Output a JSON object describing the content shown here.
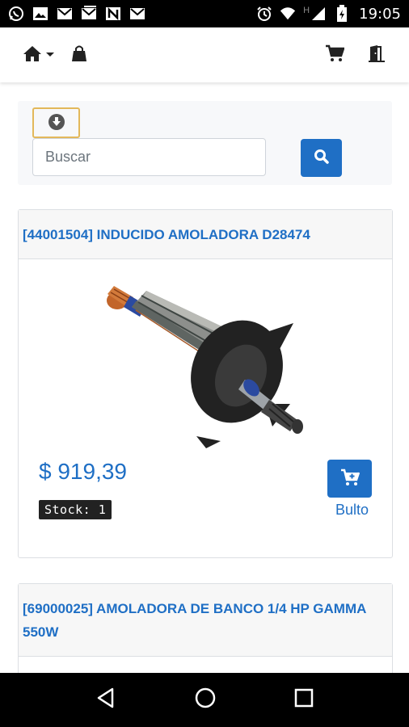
{
  "status_bar": {
    "time": "19:05",
    "network_label": "H",
    "left_icons": [
      "whatsapp-icon",
      "image-icon",
      "gmail-icon",
      "gmail-icon",
      "n-app-icon",
      "gmail-icon"
    ],
    "right_icons": [
      "alarm-icon",
      "wifi-icon",
      "signal-icon",
      "battery-charging-icon"
    ]
  },
  "navbar": {
    "icons": [
      "home-icon",
      "caret-down-icon",
      "shopping-bag-icon",
      "cart-icon",
      "exit-door-icon"
    ]
  },
  "search": {
    "placeholder": "Buscar",
    "value": ""
  },
  "products": [
    {
      "title": "[44001504] INDUCIDO AMOLADORA D28474",
      "price": "$ 919,39",
      "stock": "Stock: 1",
      "unit": "Bulto"
    },
    {
      "title": "[69000025] AMOLADORA DE BANCO 1/4 HP GAMMA 550W"
    }
  ],
  "colors": {
    "primary": "#1f6fc5",
    "download_border": "#e3b85a",
    "stock_bg": "#222222"
  }
}
